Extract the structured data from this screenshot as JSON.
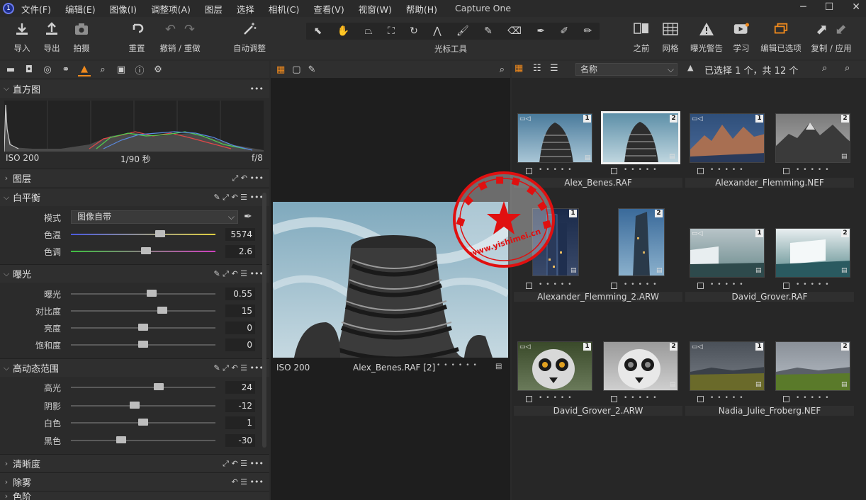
{
  "app": {
    "title": "Capture One"
  },
  "menu": [
    "文件(F)",
    "编辑(E)",
    "图像(I)",
    "调整项(A)",
    "图层",
    "选择",
    "相机(C)",
    "查看(V)",
    "视窗(W)",
    "帮助(H)"
  ],
  "window_buttons": {
    "minimize": "─",
    "maximize": "☐",
    "close": "✕"
  },
  "toolbar": {
    "import": "导入",
    "export": "导出",
    "capture": "拍摄",
    "reset": "重置",
    "undo_redo": "撤销 / 重做",
    "auto_adjust": "自动调整",
    "cursor_tools": "光标工具",
    "before": "之前",
    "grid": "网格",
    "exposure_warning": "曝光警告",
    "learn": "学习",
    "edit_selected": "编辑已选项",
    "copy_apply": "复制 / 应用"
  },
  "histogram": {
    "title": "直方图",
    "iso": "ISO 200",
    "shutter": "1/90 秒",
    "aperture": "f/8"
  },
  "layers": {
    "title": "图层"
  },
  "white_balance": {
    "title": "白平衡",
    "mode_label": "模式",
    "mode_value": "图像自带",
    "temp_label": "色温",
    "temp_value": "5574",
    "temp_pos": 0.62,
    "tint_label": "色调",
    "tint_value": "2.6",
    "tint_pos": 0.52
  },
  "exposure": {
    "title": "曝光",
    "rows": [
      {
        "label": "曝光",
        "value": "0.55",
        "pos": 0.56
      },
      {
        "label": "对比度",
        "value": "15",
        "pos": 0.63
      },
      {
        "label": "亮度",
        "value": "0",
        "pos": 0.5
      },
      {
        "label": "饱和度",
        "value": "0",
        "pos": 0.5
      }
    ]
  },
  "hdr": {
    "title": "高动态范围",
    "rows": [
      {
        "label": "高光",
        "value": "24",
        "pos": 0.61
      },
      {
        "label": "阴影",
        "value": "-12",
        "pos": 0.44
      },
      {
        "label": "白色",
        "value": "1",
        "pos": 0.5
      },
      {
        "label": "黑色",
        "value": "-30",
        "pos": 0.35
      }
    ]
  },
  "clarity": {
    "title": "清晰度"
  },
  "dehaze": {
    "title": "除雾"
  },
  "cut_section": {
    "title": "色阶"
  },
  "viewer": {
    "iso": "ISO 200",
    "caption": "Alex_Benes.RAF [2]"
  },
  "browser": {
    "sort": "名称",
    "selection": "已选择 1 个，共 12 个"
  },
  "groups": [
    {
      "name": "Alex_Benes.RAF"
    },
    {
      "name": "Alexander_Flemming.NEF"
    },
    {
      "name": "Alexander_Flemming_2.ARW"
    },
    {
      "name": "David_Grover.RAF"
    },
    {
      "name": "David_Grover_2.ARW"
    },
    {
      "name": "Nadia_Julie_Froberg.NEF"
    }
  ],
  "watermark": {
    "text": "www.yishimei.cn"
  }
}
